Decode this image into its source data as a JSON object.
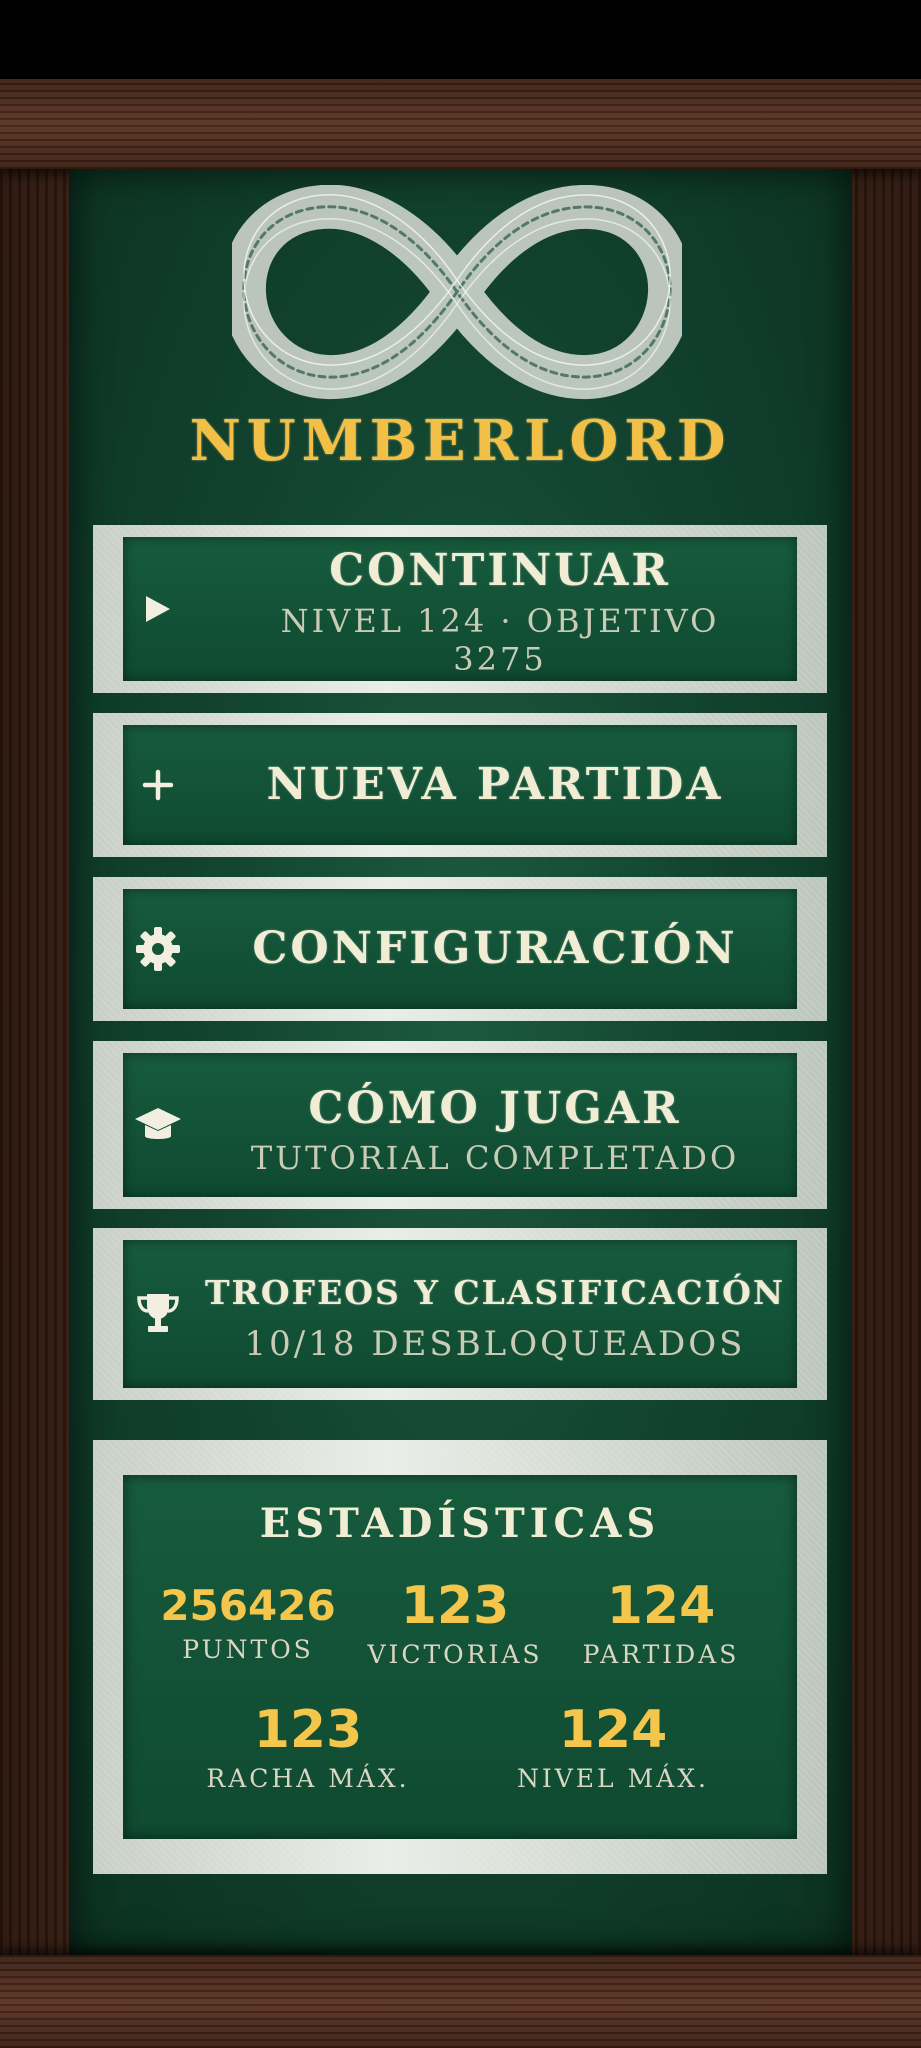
{
  "app": {
    "title": "NUMBERLORD"
  },
  "menu": {
    "continue": {
      "label": "CONTINUAR",
      "sub_line1": "NIVEL 124 · OBJETIVO",
      "sub_line2": "3275"
    },
    "new_game": {
      "label": "NUEVA PARTIDA"
    },
    "settings": {
      "label": "CONFIGURACIÓN"
    },
    "how_to": {
      "label": "CÓMO JUGAR",
      "sub": "TUTORIAL COMPLETADO"
    },
    "trophies": {
      "label": "TROFEOS Y CLASIFICACIÓN",
      "sub": "10/18 DESBLOQUEADOS"
    }
  },
  "stats": {
    "title": "ESTADÍSTICAS",
    "points": {
      "value": "256426",
      "label": "PUNTOS"
    },
    "wins": {
      "value": "123",
      "label": "VICTORIAS"
    },
    "games": {
      "value": "124",
      "label": "PARTIDAS"
    },
    "max_streak": {
      "value": "123",
      "label": "RACHA MÁX."
    },
    "max_level": {
      "value": "124",
      "label": "NIVEL MÁX."
    }
  },
  "colors": {
    "accent": "#f2c046",
    "board": "#124430",
    "chalk": "#f1ecd4"
  },
  "icons": {
    "logo": "infinity-icon",
    "continue": "play-icon",
    "new_game": "plus-icon",
    "settings": "gear-icon",
    "how_to": "graduation-cap-icon",
    "trophies": "trophy-icon"
  }
}
